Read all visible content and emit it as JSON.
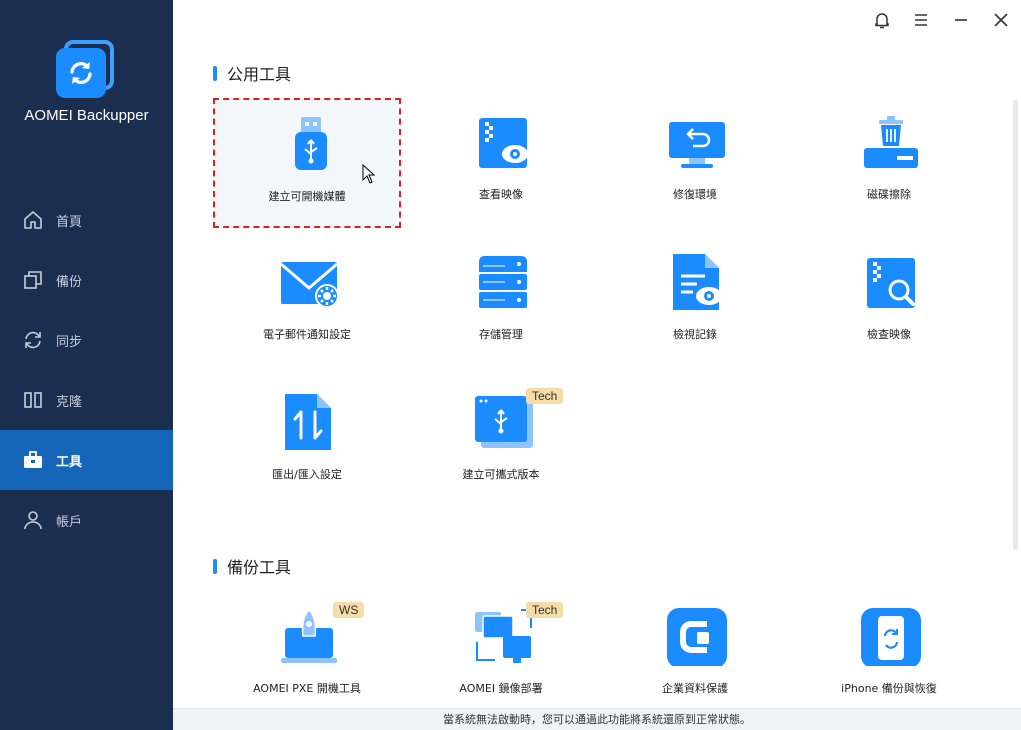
{
  "app": {
    "name": "AOMEI Backupper"
  },
  "nav": {
    "items": [
      {
        "label": "首頁",
        "icon": "home-icon"
      },
      {
        "label": "備份",
        "icon": "copy-icon"
      },
      {
        "label": "同步",
        "icon": "sync-icon"
      },
      {
        "label": "克隆",
        "icon": "clone-icon"
      },
      {
        "label": "工具",
        "icon": "toolbox-icon",
        "active": true
      },
      {
        "label": "帳戶",
        "icon": "user-icon"
      }
    ]
  },
  "topbar": {
    "icons": [
      "bell-icon",
      "menu-icon",
      "minimize-icon",
      "close-icon"
    ]
  },
  "sections": {
    "common": {
      "title": "公用工具",
      "tools": [
        {
          "label": "建立可開機媒體",
          "icon": "usb-icon",
          "selected": true
        },
        {
          "label": "查看映像",
          "icon": "view-image-icon"
        },
        {
          "label": "修復環境",
          "icon": "recovery-env-icon"
        },
        {
          "label": "磁碟擦除",
          "icon": "disk-wipe-icon"
        },
        {
          "label": "電子郵件通知設定",
          "icon": "email-settings-icon"
        },
        {
          "label": "存儲管理",
          "icon": "storage-icon"
        },
        {
          "label": "檢視記錄",
          "icon": "view-log-icon"
        },
        {
          "label": "檢查映像",
          "icon": "check-image-icon"
        },
        {
          "label": "匯出/匯入設定",
          "icon": "import-export-icon"
        },
        {
          "label": "建立可攜式版本",
          "icon": "portable-icon",
          "badge": "Tech"
        }
      ]
    },
    "backup": {
      "title": "備份工具",
      "tools": [
        {
          "label": "AOMEI PXE 開機工具",
          "icon": "pxe-icon",
          "badge": "WS"
        },
        {
          "label": "AOMEI 鏡像部署",
          "icon": "image-deploy-icon",
          "badge": "Tech"
        },
        {
          "label": "企業資料保護",
          "icon": "cyber-backup-icon"
        },
        {
          "label": "iPhone 備份與恢復",
          "icon": "iphone-backup-icon"
        }
      ]
    }
  },
  "status": {
    "text": "當系統無法啟動時，您可以通過此功能將系統還原到正常狀態。"
  },
  "colors": {
    "sidebar": "#1c2e4f",
    "accent": "#1b8cff",
    "active_nav": "#1565b8",
    "selection": "#e0201c"
  }
}
